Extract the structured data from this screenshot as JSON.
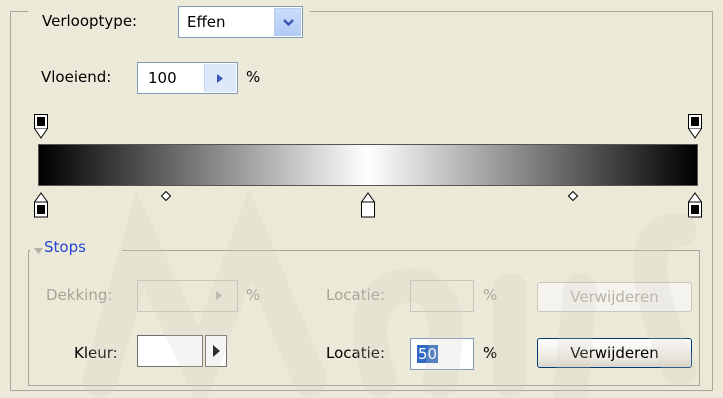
{
  "gradient_type": {
    "label": "Verlooptype:",
    "selected": "Effen"
  },
  "smoothness": {
    "label": "Vloeiend:",
    "value": "100",
    "unit": "%"
  },
  "gradient": {
    "colors": [
      "#000000",
      "#ffffff",
      "#000000"
    ]
  },
  "stops": {
    "title": "Stops",
    "opacity": {
      "label": "Dekking:",
      "value": "",
      "unit": "%",
      "location_label": "Locatie:",
      "location_value": "",
      "location_unit": "%",
      "delete_label": "Verwijderen"
    },
    "color": {
      "label": "Kleur:",
      "swatch": "#ffffff",
      "location_label": "Locatie:",
      "location_value": "50",
      "location_unit": "%",
      "delete_label": "Verwijderen"
    }
  },
  "icons": {
    "dropdown": "chevron-down-icon",
    "stepper": "triangle-right-icon",
    "color_picker": "triangle-right-icon",
    "stop": "color-stop-icon",
    "midpoint": "diamond-icon"
  }
}
